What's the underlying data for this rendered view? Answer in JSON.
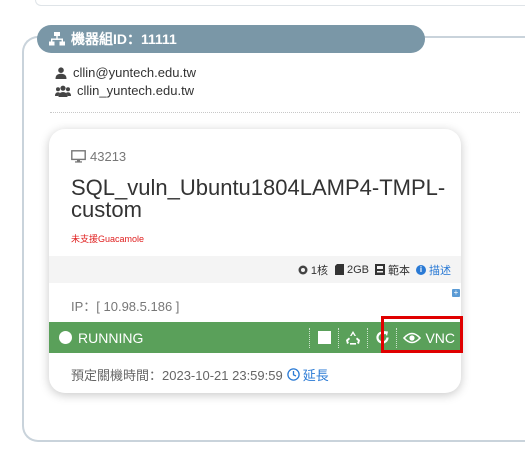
{
  "group": {
    "label": "機器組ID：11111"
  },
  "owner": {
    "email": "cllin@yuntech.edu.tw",
    "group_name": "cllin_yuntech.edu.tw"
  },
  "vm": {
    "id": "43213",
    "name": "SQL_vuln_Ubuntu1804LAMP4-TMPL-custom",
    "guacamole_warning": "未支援Guacamole",
    "specs": {
      "cores": "1核",
      "memory": "2GB",
      "template": "範本",
      "describe_link": "描述"
    },
    "ip": "IP：[ 10.98.5.186 ]",
    "status": "RUNNING",
    "vnc_label": "VNC",
    "schedule_label": "預定關機時間：2023-10-21 23:59:59",
    "extend_label": "延長"
  },
  "icons": {
    "group": "sitemap-icon",
    "user": "user-icon",
    "users": "users-icon",
    "monitor": "desktop-icon",
    "cpu": "cpu-icon",
    "memory": "sd-card-icon",
    "template": "template-icon",
    "info": "info-icon",
    "stop": "stop-icon",
    "recycle": "recycle-icon",
    "restart": "restart-icon",
    "eye": "eye-icon",
    "clock": "clock-icon"
  },
  "colors": {
    "header_bg": "#7a97a7",
    "running_green": "#5aa05a",
    "link_blue": "#2a7ad5",
    "warning_red": "#e02020",
    "highlight_red": "#e00000"
  }
}
